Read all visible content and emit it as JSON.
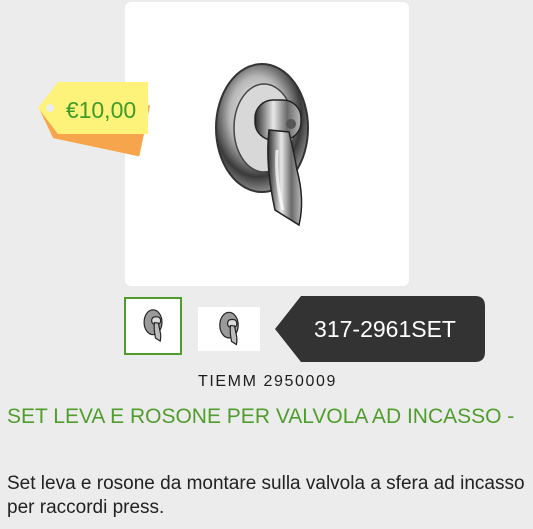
{
  "price": {
    "label": "€10,00",
    "tag_colors": {
      "front": "#fdf37a",
      "back": "#f7a54d",
      "text": "#3f9a2a"
    }
  },
  "product_image": {
    "icon": "mixer-lever-icon"
  },
  "thumbnails": [
    {
      "icon": "mixer-lever-icon",
      "selected": true
    },
    {
      "icon": "mixer-lever-icon",
      "selected": false
    }
  ],
  "code_badge": {
    "label": "317-2961SET",
    "color": "#333333"
  },
  "brand_code": "TIEMM 2950009",
  "title": "SET LEVA E ROSONE PER VALVOLA AD INCASSO -",
  "description": "Set leva e rosone da montare sulla valvola a sfera ad incasso per raccordi press.",
  "colors": {
    "accent": "#4f9d2d",
    "background": "#ececec"
  }
}
